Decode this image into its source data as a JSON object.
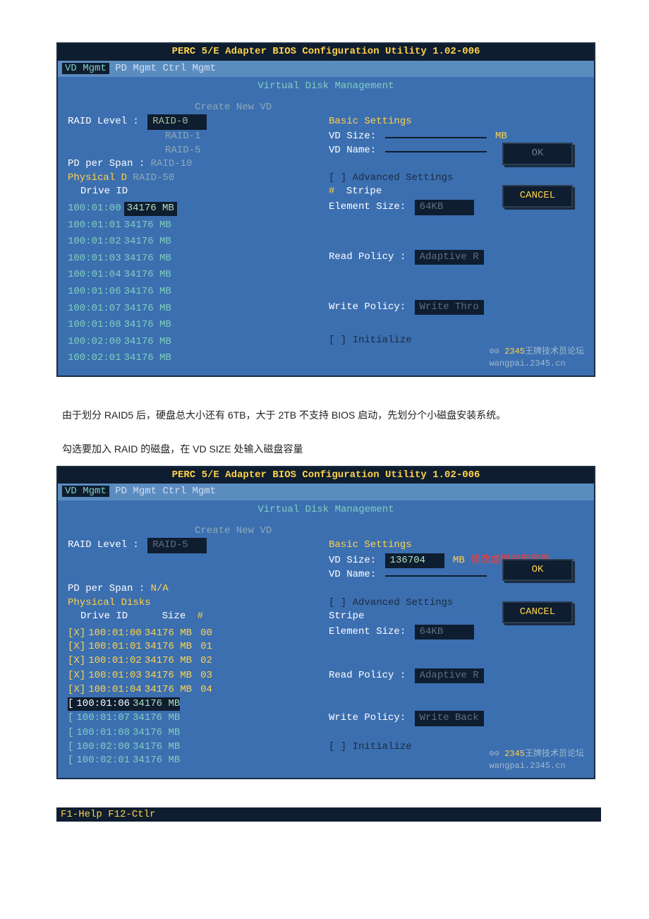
{
  "bios": {
    "title": "PERC 5/E Adapter BIOS Configuration Utility 1.02-006",
    "menu": {
      "vd": "VD Mgmt",
      "pd": "PD Mgmt",
      "ctrl": "Ctrl Mgmt"
    },
    "vdm": "Virtual Disk Management",
    "create": "Create New VD",
    "raid_level_lbl": "RAID Level :",
    "pd_per_span_lbl": "PD per Span :",
    "pd_per_span_val_na": "N/A",
    "physical_header": "Physical D",
    "physical_header2": "Physical Disks",
    "drive_id_lbl": "Drive ID",
    "size_lbl": "Size",
    "col_hash": "#",
    "raid_options": [
      "RAID-0",
      "RAID-1",
      "RAID-5",
      "RAID-10",
      "RAID-50"
    ],
    "raid_sel1": "RAID-0",
    "raid_sel2": "RAID-5",
    "basic_settings": "Basic Settings",
    "vd_size_lbl": "VD Size:",
    "vd_size_unit": "MB",
    "vd_size_val2": "136704",
    "vd_size_note2": "修改虚拟磁盘容量",
    "vd_name_lbl": "VD Name:",
    "adv_settings": "[ ] Advanced Settings",
    "stripe_lbl": "Stripe",
    "element_size_lbl": "Element Size:",
    "element_size_val": "64KB",
    "read_policy_lbl": "Read Policy :",
    "read_policy_val": "Adaptive R",
    "write_policy_lbl": "Write Policy:",
    "write_policy_val1": "Write Thro",
    "write_policy_val2": "Write Back",
    "initialize": "[ ] Initialize",
    "ok": "OK",
    "cancel": "CANCEL",
    "drives1": [
      {
        "id": "100:01:00",
        "size": "34176 MB"
      },
      {
        "id": "100:01:01",
        "size": "34176 MB"
      },
      {
        "id": "100:01:02",
        "size": "34176 MB"
      },
      {
        "id": "100:01:03",
        "size": "34176 MB"
      },
      {
        "id": "100:01:04",
        "size": "34176 MB"
      },
      {
        "id": "100:01:06",
        "size": "34176 MB"
      },
      {
        "id": "100:01:07",
        "size": "34176 MB"
      },
      {
        "id": "100:01:08",
        "size": "34176 MB"
      },
      {
        "id": "100:02:00",
        "size": "34176 MB"
      },
      {
        "id": "100:02:01",
        "size": "34176 MB"
      }
    ],
    "drives2": [
      {
        "mark": "[X]",
        "id": "100:01:00",
        "size": "34176 MB",
        "n": "00"
      },
      {
        "mark": "[X]",
        "id": "100:01:01",
        "size": "34176 MB",
        "n": "01"
      },
      {
        "mark": "[X]",
        "id": "100:01:02",
        "size": "34176 MB",
        "n": "02"
      },
      {
        "mark": "[X]",
        "id": "100:01:03",
        "size": "34176 MB",
        "n": "03"
      },
      {
        "mark": "[X]",
        "id": "100:01:04",
        "size": "34176 MB",
        "n": "04"
      },
      {
        "mark": "[ ",
        "id": "100:01:06",
        "size": "34176 MB",
        "n": "--"
      },
      {
        "mark": "[ ",
        "id": "100:01:07",
        "size": "34176 MB",
        "n": "--"
      },
      {
        "mark": "[ ",
        "id": "100:01:08",
        "size": "34176 MB",
        "n": "--"
      },
      {
        "mark": "[ ",
        "id": "100:02:00",
        "size": "34176 MB",
        "n": "--"
      },
      {
        "mark": "[ ",
        "id": "100:02:01",
        "size": "34176 MB",
        "n": "--"
      }
    ],
    "watermark_brand": "2345",
    "watermark_text": "王牌技术员论坛",
    "watermark_url": "wangpai.2345.cn",
    "footkeys": "F1-Help  F12-Ctlr"
  },
  "doc": {
    "para1": "由于划分 RAID5 后，硬盘总大小还有 6TB，大于 2TB 不支持 BIOS 启动，先划分个小磁盘安装系统。",
    "para2": "勾选要加入 RAID 的磁盘，在 VD SIZE 处输入磁盘容量"
  }
}
